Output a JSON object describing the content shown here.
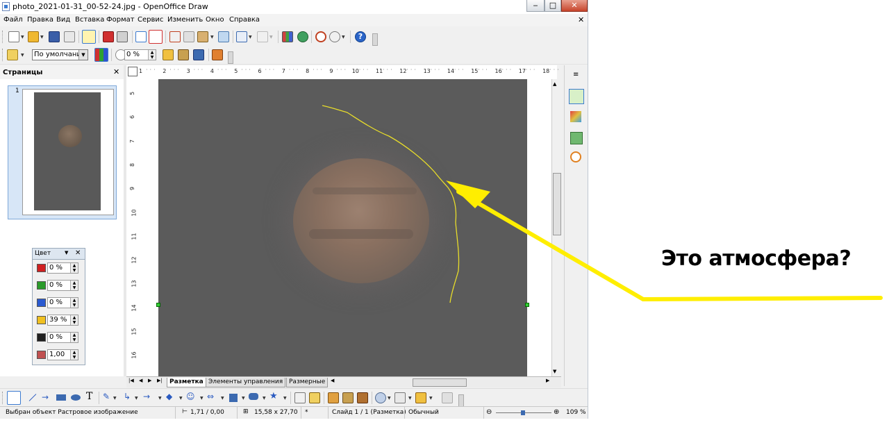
{
  "window": {
    "title": "photo_2021-01-31_00-52-24.jpg - OpenOffice Draw",
    "caption_minimize": "‒",
    "caption_maximize": "□",
    "caption_close": "✕",
    "doc_close": "✕"
  },
  "menu": [
    "Файл",
    "Правка",
    "Вид",
    "Вставка",
    "Формат",
    "Сервис",
    "Изменить",
    "Окно",
    "Справка"
  ],
  "toolbar2": {
    "style_combo": "По умолчании",
    "transparency": "0 %"
  },
  "pages_panel": {
    "title": "Страницы",
    "close": "✕",
    "page_number": "1"
  },
  "color_panel": {
    "title": "Цвет",
    "close": "✕",
    "values": [
      "0 %",
      "0 %",
      "0 %",
      "39 %",
      "0 %",
      "1,00"
    ],
    "colors": [
      "#d02020",
      "#2a9a2a",
      "#2a5ad0",
      "#f0c020",
      "#202020",
      "#c05050"
    ]
  },
  "ruler": {
    "h_ticks": [
      "1",
      "2",
      "3",
      "4",
      "5",
      "6",
      "7",
      "8",
      "9",
      "10",
      "11",
      "12",
      "13",
      "14",
      "15",
      "16",
      "17",
      "18"
    ],
    "v_ticks": [
      "5",
      "6",
      "7",
      "8",
      "9",
      "10",
      "11",
      "12",
      "13",
      "14",
      "15",
      "16"
    ]
  },
  "tabs": [
    "Разметка",
    "Элементы управления",
    "Размерные"
  ],
  "status": {
    "object": "Выбран объект Растровое изображение",
    "position": "1,71 / 0,00",
    "size": "15,58 x 27,70",
    "modified": "*",
    "slide": "Слайд 1 / 1 (Разметка)",
    "style": "Обычный",
    "zoom": "109 %"
  },
  "annotation": {
    "text": "Это атмосфера?",
    "color": "#ffee00"
  },
  "sidebar_icons": [
    "properties-icon",
    "styles-icon",
    "gallery-icon",
    "navigator-icon"
  ],
  "accent": "#3c7bd0"
}
